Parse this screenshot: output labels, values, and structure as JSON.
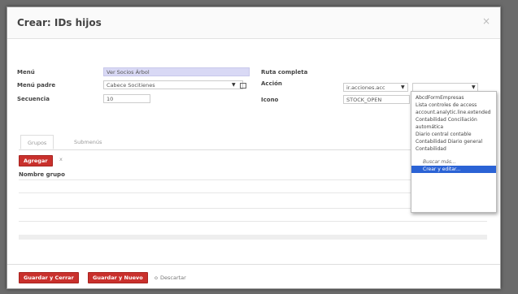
{
  "dialog": {
    "title": "Crear: IDs hijos",
    "close": "×"
  },
  "form": {
    "menu_label": "Menú",
    "menu_value": "Ver Socios Árbol",
    "parent_label": "Menú padre",
    "parent_value": "Cabece Socitienes",
    "sequence_label": "Secuencia",
    "sequence_value": "10",
    "fullpath_label": "Ruta completa",
    "action_label": "Acción",
    "action_value": "ir.acciones.acc",
    "icon_label": "Icono",
    "icon_value": "STOCK_OPEN"
  },
  "tabs": [
    {
      "label": "Grupos"
    },
    {
      "label": "Submenús"
    }
  ],
  "grid": {
    "add_label": "Agregar",
    "add_suffix": "x",
    "column": "Nombre grupo"
  },
  "footer": {
    "save_close": "Guardar y Cerrar",
    "save_new": "Guardar y Nuevo",
    "or": "o",
    "discard": "Descartar"
  },
  "dropdown": {
    "items": [
      "AbcdFormEmpresas",
      "Lista controles de access",
      "account.analytic.line.extended",
      "Contabilidad  Conciliación",
      "automática",
      "Diario central contable",
      "Contabilidad  Diario general",
      "Contabilidad"
    ],
    "search_more": "Buscar más...",
    "create_edit": "Crear y editar..."
  }
}
